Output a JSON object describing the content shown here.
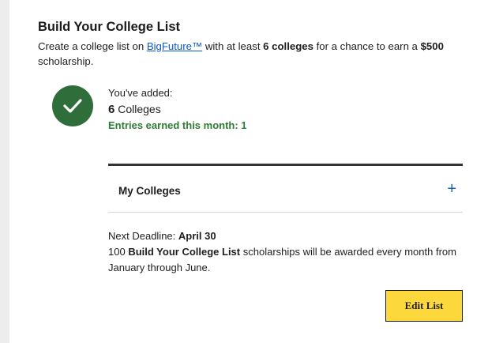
{
  "card": {
    "title": "Build Your College List",
    "desc_before": "Create a college list on ",
    "link_text": "BigFuture™",
    "desc_middle": " with at least ",
    "desc_bold_count": "6 colleges",
    "desc_after": " for a chance to earn a ",
    "desc_bold_amount": "$500",
    "desc_end": " scholarship."
  },
  "status": {
    "icon": "check-icon",
    "added_label": "You've added:",
    "count": "6",
    "count_unit": "Colleges",
    "entries": "Entries earned this month: 1",
    "accent_color": "#2f6e3a",
    "entries_color": "#2e7d32"
  },
  "my_colleges": {
    "label": "My Colleges",
    "toggle_icon": "plus-icon",
    "toggle_symbol": "+"
  },
  "deadline": {
    "prefix": "Next Deadline: ",
    "date": "April 30",
    "line2_start": "100 ",
    "line2_bold": "Build Your College List",
    "line2_end": " scholarships will be awarded every month from January through June."
  },
  "button": {
    "label": "Edit List",
    "color": "#fcd83d"
  }
}
